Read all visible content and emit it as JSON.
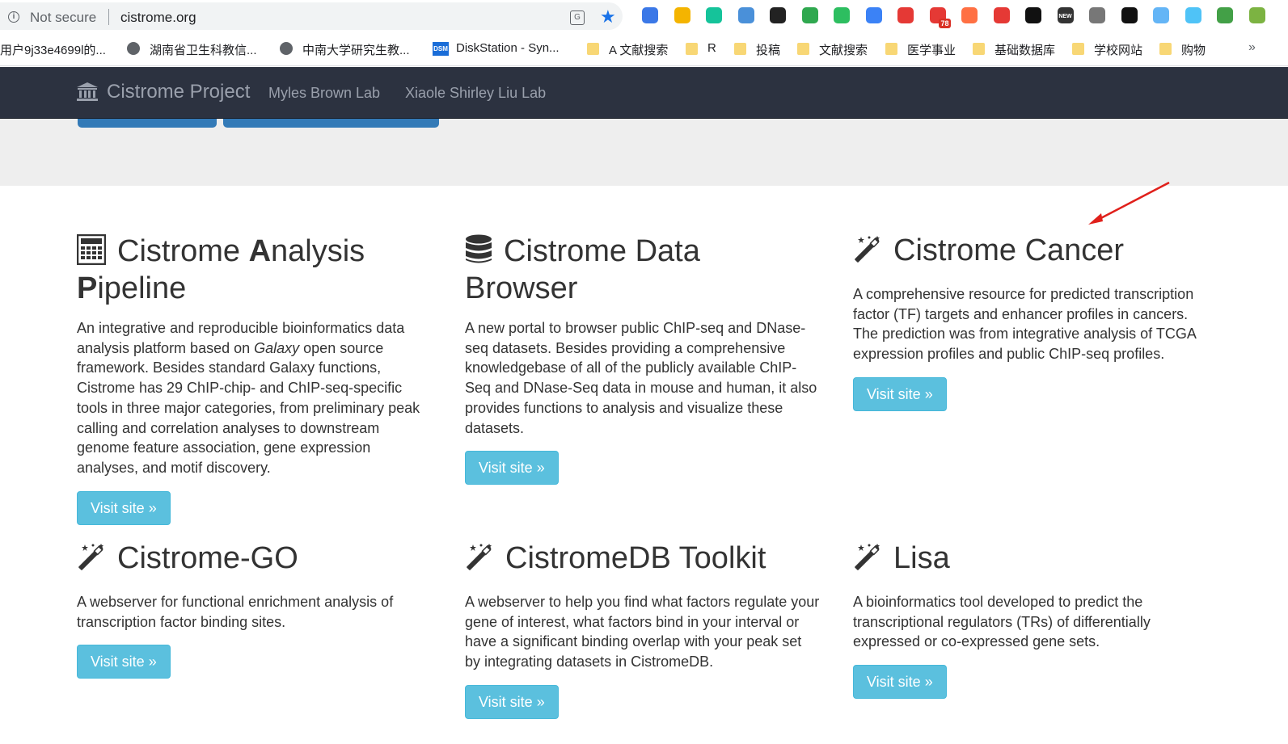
{
  "browser": {
    "security_label": "Not secure",
    "url": "cistrome.org",
    "extensions": [
      {
        "icon": "puzzle-icon",
        "color": "#3b78e7"
      },
      {
        "icon": "flask-icon",
        "color": "#f4b400"
      },
      {
        "icon": "grammarly-icon",
        "color": "#15c39a"
      },
      {
        "icon": "feed-icon",
        "color": "#4a90d9"
      },
      {
        "icon": "mask-icon",
        "color": "#222222"
      },
      {
        "icon": "diamond-icon",
        "color": "#2fa84f"
      },
      {
        "icon": "evernote-icon",
        "color": "#2dbe60"
      },
      {
        "icon": "pen-icon",
        "color": "#3b82f6"
      },
      {
        "icon": "chart-icon",
        "color": "#e53935"
      },
      {
        "icon": "mail-icon",
        "color": "#e53935",
        "badge": "78"
      },
      {
        "icon": "ring-icon",
        "color": "#ff7043"
      },
      {
        "icon": "grid-icon",
        "color": "#e53935"
      },
      {
        "icon": "lock-icon",
        "color": "#111111"
      },
      {
        "icon": "news-icon",
        "color": "#333333",
        "label": "NEW"
      },
      {
        "icon": "brain-icon",
        "color": "#777777"
      },
      {
        "icon": "fish-icon",
        "color": "#111111"
      },
      {
        "icon": "check-icon",
        "color": "#64b5f6"
      },
      {
        "icon": "cloud-icon",
        "color": "#4fc3f7"
      },
      {
        "icon": "shield-icon",
        "color": "#43a047"
      },
      {
        "icon": "earth-icon",
        "color": "#7cb342"
      }
    ],
    "bookmarks": [
      {
        "label": "用户9j33e4699l的...",
        "icon": "none"
      },
      {
        "label": "湖南省卫生科教信...",
        "icon": "globe-icon"
      },
      {
        "label": "中南大学研究生教...",
        "icon": "globe-icon"
      },
      {
        "label": "DiskStation - Syn...",
        "icon": "dsm-icon",
        "icon_text": "DSM"
      },
      {
        "label": "A 文献搜索",
        "icon": "folder-icon"
      },
      {
        "label": "R",
        "icon": "folder-icon"
      },
      {
        "label": "投稿",
        "icon": "folder-icon"
      },
      {
        "label": "文献搜索",
        "icon": "folder-icon"
      },
      {
        "label": "医学事业",
        "icon": "folder-icon"
      },
      {
        "label": "基础数据库",
        "icon": "folder-icon"
      },
      {
        "label": "学校网站",
        "icon": "folder-icon"
      },
      {
        "label": "购物",
        "icon": "folder-icon"
      }
    ],
    "bookmarks_more": "»"
  },
  "navbar": {
    "brand": "Cistrome Project",
    "links": [
      "Myles Brown Lab",
      "Xiaole Shirley Liu Lab"
    ]
  },
  "cards": [
    {
      "icon": "calculator-icon",
      "title_html": "Cistrome <b>A</b>nalysis <b>P</b>ipeline",
      "title": "Cistrome Analysis Pipeline",
      "description_parts": [
        "An integrative and reproducible bioinformatics data analysis platform based on ",
        "Galaxy",
        " open source framework. Besides standard Galaxy functions, Cistrome has 29 ChIP-chip- and ChIP-seq-specific tools in three major categories, from preliminary peak calling and correlation analyses to downstream genome feature association, gene expression analyses, and motif discovery."
      ],
      "button": "Visit site »"
    },
    {
      "icon": "database-icon",
      "title": "Cistrome Data Browser",
      "description": "A new portal to browser public ChIP-seq and DNase-seq datasets. Besides providing a comprehensive knowledgebase of all of the publicly available ChIP-Seq and DNase-Seq data in mouse and human, it also provides functions to analysis and visualize these datasets.",
      "button": "Visit site »"
    },
    {
      "icon": "magic-wand-icon",
      "title": "Cistrome Cancer",
      "description": "A comprehensive resource for predicted transcription factor (TF) targets and enhancer profiles in cancers. The prediction was from integrative analysis of TCGA expression profiles and public ChIP-seq profiles.",
      "button": "Visit site »"
    },
    {
      "icon": "magic-wand-icon",
      "title": "Cistrome-GO",
      "description": "A webserver for functional enrichment analysis of transcription factor binding sites.",
      "button": "Visit site »"
    },
    {
      "icon": "magic-wand-icon",
      "title": "CistromeDB Toolkit",
      "description": "A webserver to help you find what factors regulate your gene of interest, what factors bind in your interval or have a significant binding overlap with your peak set by integrating datasets in CistromeDB.",
      "button": "Visit site »"
    },
    {
      "icon": "magic-wand-icon",
      "title": "Lisa",
      "description": "A bioinformatics tool developed to predict the transcriptional regulators (TRs) of differentially expressed or co-expressed gene sets.",
      "button": "Visit site »"
    }
  ],
  "colors": {
    "navbar_bg": "#2c3240",
    "button_info": "#5bc0de",
    "hero_bg": "#eeeeee",
    "primary_button": "#337ab7",
    "annotation_arrow": "#e0201b"
  },
  "annotation": {
    "type": "arrow",
    "points_to": "Cistrome Cancer"
  }
}
